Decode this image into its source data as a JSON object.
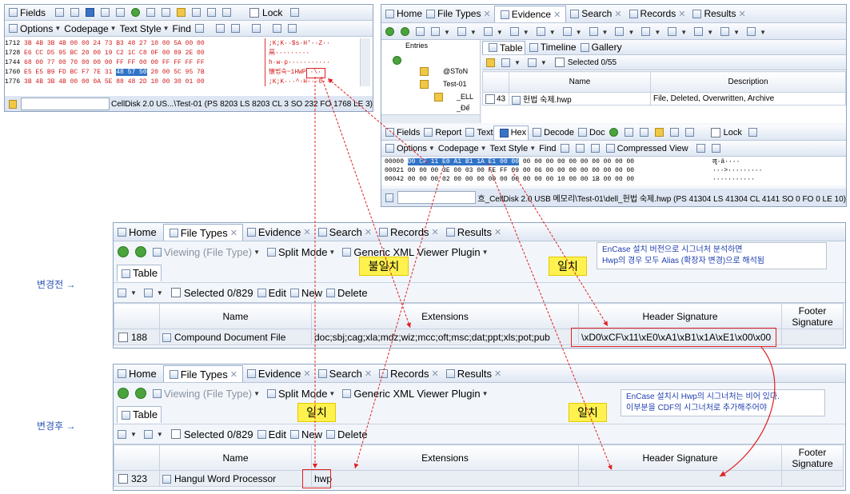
{
  "hex_window": {
    "toolbar1": [
      "Fields",
      "Lock"
    ],
    "toolbar2": {
      "options": "Options",
      "codepage": "Codepage",
      "text_style": "Text Style",
      "find": "Find"
    },
    "rows": [
      {
        "off": "1712",
        "hex": "3B 4B 3B 4B 00 00 24 73 B3 48 27 10 00 5A 00 00",
        "txt": ";K;K··$s·H'··Z··"
      },
      {
        "off": "1728",
        "hex": "E6 CC D5 95 BC 20 00 19 C2 1C C8 0F 00 89 2E 00",
        "txt": "鬲·········"
      },
      {
        "off": "1744",
        "hex": "68 00 77 00 70 00 00 00 FF FF 00 00 FF FF FF FF",
        "txt": "h·w·p···········"
      },
      {
        "off": "1760",
        "hex": "E5 E5 B9 FD BC F7 7E 31 48 57 50 20 00 5C 95 7B",
        "txt": "懐법숙~1HWP ·\\·"
      },
      {
        "off": "1776",
        "hex": "3B 4B 3B 4B 00 00 0A 5E 88 48 2D 10 00 30 01 00",
        "txt": ";K;K···^·H-··0··"
      }
    ],
    "status": "CellDisk 2.0 US...\\Test-01 (PS 8203 LS 8203 CL 3 SO 232 FO 1768 LE 3)"
  },
  "encase_window": {
    "tabs": [
      "Home",
      "File Types",
      "Evidence",
      "Search",
      "Records",
      "Results"
    ],
    "tree": [
      "Entries",
      "@SToN",
      "Test-01",
      "_ELL",
      "_Đế"
    ],
    "view_tabs": [
      "Table",
      "Timeline",
      "Gallery"
    ],
    "selected": "Selected 0/55",
    "columns": [
      "Name",
      "Description"
    ],
    "row": {
      "num": "43",
      "name": "헌법 숙제.hwp",
      "desc": "File, Deleted, Overwritten, Archive"
    },
    "lower_tabs": [
      "Fields",
      "Report",
      "Text",
      "Hex",
      "Decode",
      "Doc",
      "Lock"
    ],
    "lower_toolbar": {
      "options": "Options",
      "codepage": "Codepage",
      "text_style": "Text Style",
      "find": "Find",
      "compressed": "Compressed View"
    },
    "hex_rows": [
      {
        "off": "00000",
        "hex": "D0 CF 11 E0 A1 B1 1A E1 00 00 00 00 00 00 00 00 00 00 00 00",
        "txt": "ॡ·ä····"
      },
      {
        "off": "00021",
        "hex": "00 00 00 3E 00 03 00 FE FF 09 00 06 00 00 00 00 00 00 00 00",
        "txt": "···>·········"
      },
      {
        "off": "00042",
        "hex": "00 00 00 02 00 00 00 00 00 00 00 00 00 10 00 00 1B 00 00 00",
        "txt": "···········"
      }
    ],
    "status": "흐_CellDisk 2.0 USB 메모리\\Test-01\\dell_헌법 숙제.hwp (PS 41304 LS 41304 CL 4141 SO 0 FO 0 LE 10)"
  },
  "panel_before": {
    "side_label": "변경전 →",
    "tabs": [
      "Home",
      "File Types",
      "Evidence",
      "Search",
      "Records",
      "Results"
    ],
    "toolbar": {
      "viewing": "Viewing (File Type)",
      "split": "Split Mode",
      "plugin": "Generic XML Viewer Plugin"
    },
    "table_tab": "Table",
    "selected": "Selected 0/829",
    "edit": "Edit",
    "new": "New",
    "delete": "Delete",
    "columns": {
      "name": "Name",
      "ext": "Extensions",
      "header": "Header Signature",
      "footer": "Footer Signature"
    },
    "row": {
      "num": "188",
      "name": "Compound Document File",
      "ext": "doc;sbj;cag;xla;mdz;wiz;mcc;oft;msc;dat;ppt;xls;pot;pub",
      "header": "\\xD0\\xCF\\x11\\xE0\\xA1\\xB1\\x1A\\xE1\\x00\\x00",
      "footer": ""
    },
    "callout_mismatch": "불일치",
    "callout_match": "일치",
    "note": [
      "EnCase 설치 버전으로 시그너처 분석하면",
      "Hwp의 경우 모두 Alias (확장자 변경)으로 해석됨"
    ]
  },
  "panel_after": {
    "side_label": "변경후 →",
    "tabs": [
      "Home",
      "File Types",
      "Evidence",
      "Search",
      "Records",
      "Results"
    ],
    "toolbar": {
      "viewing": "Viewing (File Type)",
      "split": "Split Mode",
      "plugin": "Generic XML Viewer Plugin"
    },
    "table_tab": "Table",
    "selected": "Selected 0/829",
    "edit": "Edit",
    "new": "New",
    "delete": "Delete",
    "columns": {
      "name": "Name",
      "ext": "Extensions",
      "header": "Header Signature",
      "footer": "Footer Signature"
    },
    "row": {
      "num": "323",
      "name": "Hangul Word Processor",
      "ext": "hwp",
      "header": "",
      "footer": ""
    },
    "callout_match1": "일치",
    "callout_match2": "일치",
    "note": [
      "EnCase 설치시 Hwp의 시그너처는 비어 있다.",
      "이부분을 CDF의 시그너처로 추가해주어야"
    ]
  },
  "colors": {
    "selection": "#3074c7",
    "callout": "#fff24f",
    "arrow": "#e02020",
    "label": "#2a55b5"
  }
}
